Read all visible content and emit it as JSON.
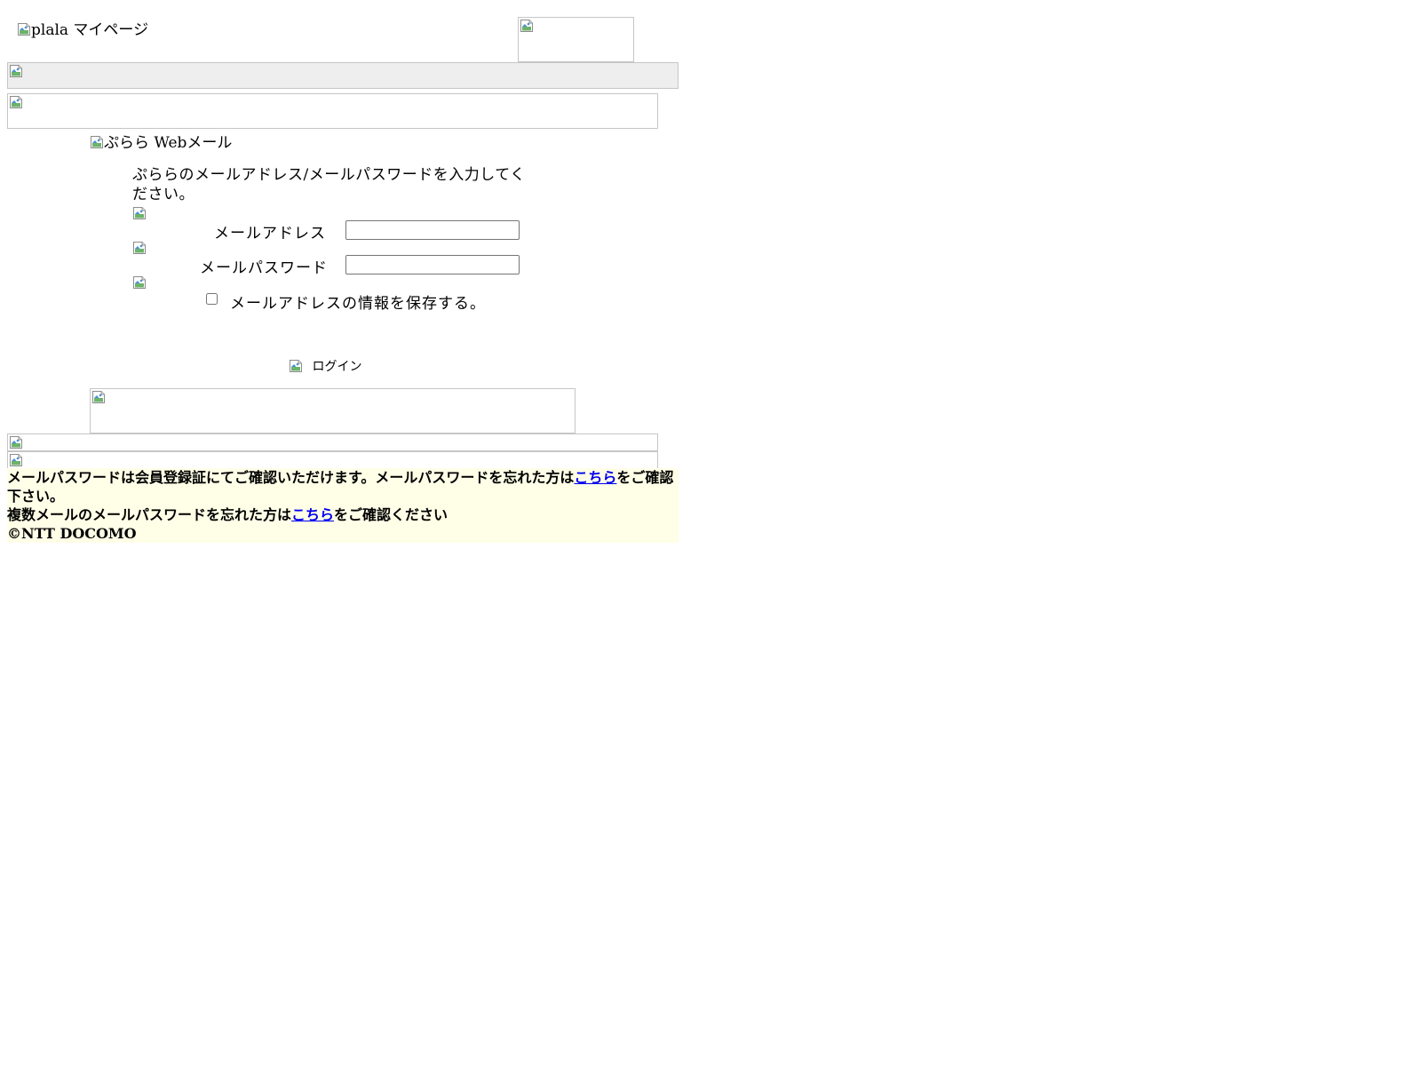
{
  "header": {
    "logo_alt": "plala マイページ"
  },
  "login": {
    "title_alt": "ぷらら Webメール",
    "instruction": "ぷららのメールアドレス/メールパスワードを入力してください。",
    "email_label": "メールアドレス",
    "password_label": "メールパスワード",
    "remember_label": "メールアドレスの情報を保存する。",
    "login_label": "ログイン",
    "email_value": "",
    "password_value": ""
  },
  "footer": {
    "note1_text": "メールパスワードは会員登録証にてご確認いただけます。メールパスワードを忘れた方は",
    "note1_link": "こちら",
    "note1_suffix": "をご確認下さい。",
    "note2_text": "複数メールのメールパスワードを忘れた方は",
    "note2_link": "こちら",
    "note2_suffix": "をご確認ください",
    "copyright": "©NTT DOCOMO"
  },
  "colors": {
    "nav_bar": "#eeeeee",
    "footer_bg": "#ffffe8",
    "link": "#0000ee"
  }
}
